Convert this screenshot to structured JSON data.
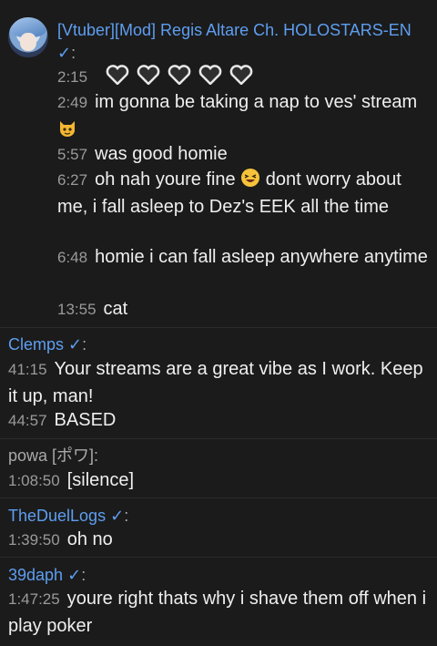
{
  "groups": [
    {
      "author": "[Vtuber][Mod] Regis Altare Ch. HOLOSTARS-EN",
      "verified": "✓",
      "colon": ":",
      "messages": [
        {
          "time": "2:15",
          "text": ""
        },
        {
          "time": "2:49",
          "text": "im gonna be taking a nap to ves' stream"
        },
        {
          "time": "5:57",
          "text": "was good homie"
        },
        {
          "time": "6:27",
          "text": "oh nah youre fine",
          "text2": "dont worry about me, i fall asleep to Dez's EEK all the time"
        },
        {
          "time": "6:48",
          "text": "homie i can fall asleep anywhere anytime"
        },
        {
          "time": "13:55",
          "text": "cat"
        }
      ]
    },
    {
      "author": "Clemps",
      "verified": "✓",
      "colon": ":",
      "messages": [
        {
          "time": "41:15",
          "text": "Your streams are a great vibe as I work. Keep it up, man!"
        },
        {
          "time": "44:57",
          "text": "BASED"
        }
      ]
    },
    {
      "author": "powa [ポワ]",
      "colon": ":",
      "messages": [
        {
          "time": "1:08:50",
          "text": "[silence]"
        }
      ]
    },
    {
      "author": "TheDuelLogs",
      "verified": "✓",
      "colon": ":",
      "messages": [
        {
          "time": "1:39:50",
          "text": "oh no"
        }
      ]
    },
    {
      "author": "39daph",
      "verified": "✓",
      "colon": ":",
      "messages": [
        {
          "time": "1:47:25",
          "text": "youre right thats why i shave them off when i play poker"
        }
      ]
    }
  ],
  "icons": {
    "heart_emotes": [
      "heart-emote-icon",
      "heart-emote-icon",
      "heart-emote-icon",
      "heart-emote-icon",
      "heart-emote-icon"
    ],
    "cat_emoji": "cat-face-icon",
    "laugh_emoji": "laughing-face-icon"
  },
  "colors": {
    "background": "#1b1b1b",
    "author_blue": "#5e9ef0",
    "author_gray": "#a9a9a9",
    "timestamp": "#9a9a9a",
    "text": "#efefef"
  }
}
